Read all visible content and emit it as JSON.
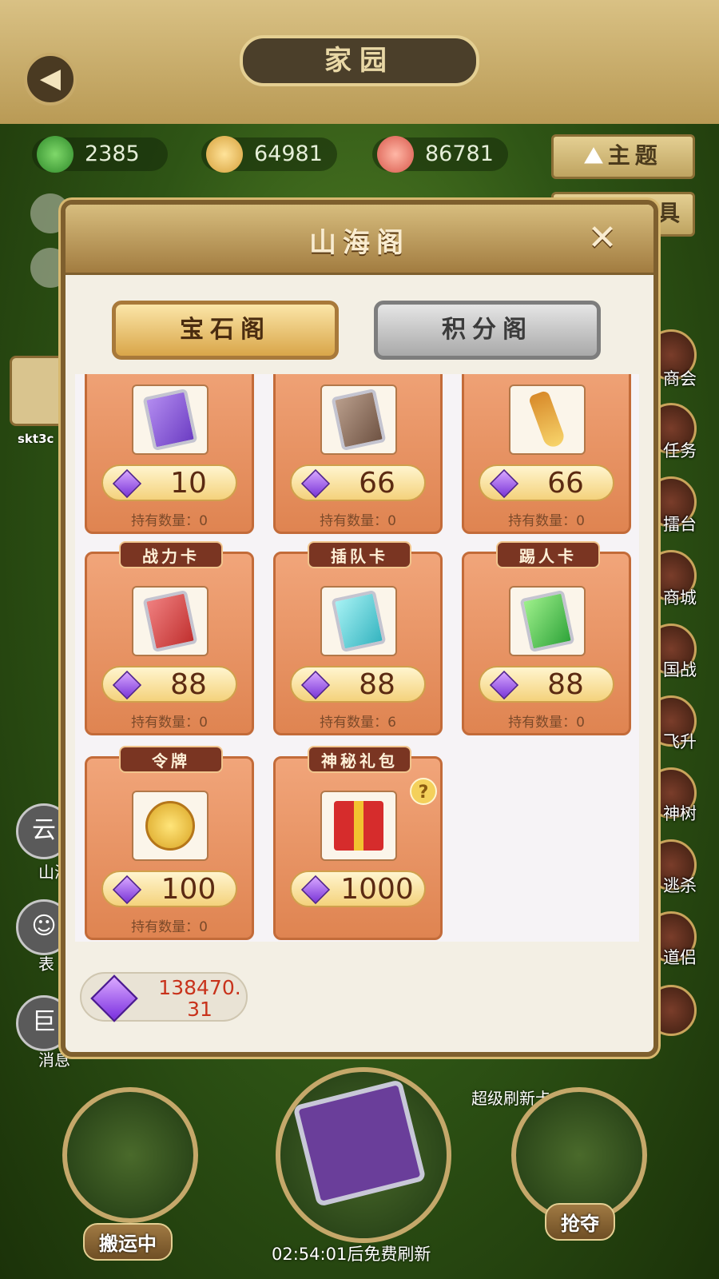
{
  "header": {
    "title": "家园",
    "back_icon": "back-arrow-icon"
  },
  "resources": [
    {
      "value": "2385",
      "color": "#2f8a2a"
    },
    {
      "value": "64981",
      "color": "#d6a03a"
    },
    {
      "value": "86781",
      "color": "#d8574a"
    }
  ],
  "theme_button": {
    "label": "主题"
  },
  "theme_button2": {
    "label": "具"
  },
  "player": {
    "name": "skt3c"
  },
  "right_menu": [
    "商会",
    "任务",
    "擂台",
    "商城",
    "国战",
    "飞升",
    "神树",
    "逃杀",
    "道侣"
  ],
  "left_menu": [
    {
      "label": "山海",
      "glyph": "云"
    },
    {
      "label": "表",
      "glyph": "☺"
    },
    {
      "label": "消息",
      "glyph": "巨"
    }
  ],
  "bottom": {
    "carry": "搬运中",
    "rob": "抢夺",
    "refresh_card_label": "超级刷新卡",
    "timer": "02:54:01后免费刷新"
  },
  "modal": {
    "title": "山海阁",
    "close_label": "✕",
    "tabs": {
      "gem": "宝石阁",
      "points": "积分阁"
    },
    "owned_prefix": "持有数量：",
    "items": [
      {
        "name": "",
        "price": "10",
        "owned": "0",
        "icon": "purple-card-icon"
      },
      {
        "name": "",
        "price": "66",
        "owned": "0",
        "icon": "brown-card-icon"
      },
      {
        "name": "",
        "price": "66",
        "owned": "0",
        "icon": "golden-shovel-icon"
      },
      {
        "name": "战力卡",
        "price": "88",
        "owned": "0",
        "icon": "red-card-icon"
      },
      {
        "name": "插队卡",
        "price": "88",
        "owned": "6",
        "icon": "cyan-card-icon"
      },
      {
        "name": "踢人卡",
        "price": "88",
        "owned": "0",
        "icon": "green-card-icon"
      },
      {
        "name": "令牌",
        "price": "100",
        "owned": "0",
        "icon": "gold-token-icon"
      },
      {
        "name": "神秘礼包",
        "price": "1000",
        "owned": "",
        "icon": "gift-box-icon"
      }
    ],
    "balance": "138470.31"
  },
  "colors": {
    "gem": "#7b37d8",
    "balance_text": "#c8321b",
    "card_bg": "#df8451"
  }
}
